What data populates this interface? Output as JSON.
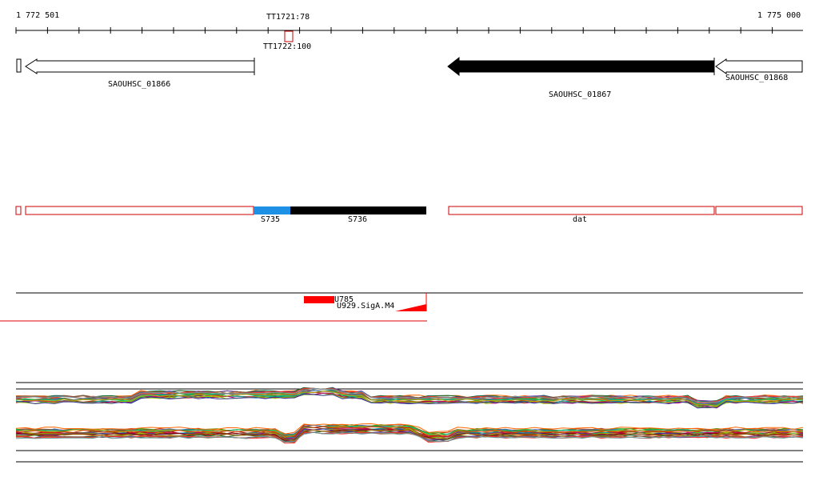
{
  "ruler": {
    "start_label": "1 772 501",
    "end_label": "1 775 000",
    "terminator_top_label": "TT1721:78",
    "terminator_bottom_label": "TT1722:100"
  },
  "genes": [
    {
      "id": "SAOUHSC_01866",
      "label": "SAOUHSC_01866",
      "strand": "-",
      "fill": "#ffffff"
    },
    {
      "id": "SAOUHSC_01867",
      "label": "SAOUHSC_01867",
      "strand": "-",
      "fill": "#000000"
    },
    {
      "id": "SAOUHSC_01868",
      "label": "SAOUHSC_01868",
      "strand": "-",
      "fill": "#ffffff"
    }
  ],
  "segments": [
    {
      "label": "S735",
      "color": "#1e90e6"
    },
    {
      "label": "S736",
      "color": "#000000"
    },
    {
      "label": "dat",
      "color": "#ffffff"
    }
  ],
  "features": {
    "primary_label": "U785",
    "secondary_label": "U929.SigA.M4",
    "accent": "#ff0000"
  },
  "colors": {
    "outline_red": "#cc0000",
    "line": "#000000"
  }
}
